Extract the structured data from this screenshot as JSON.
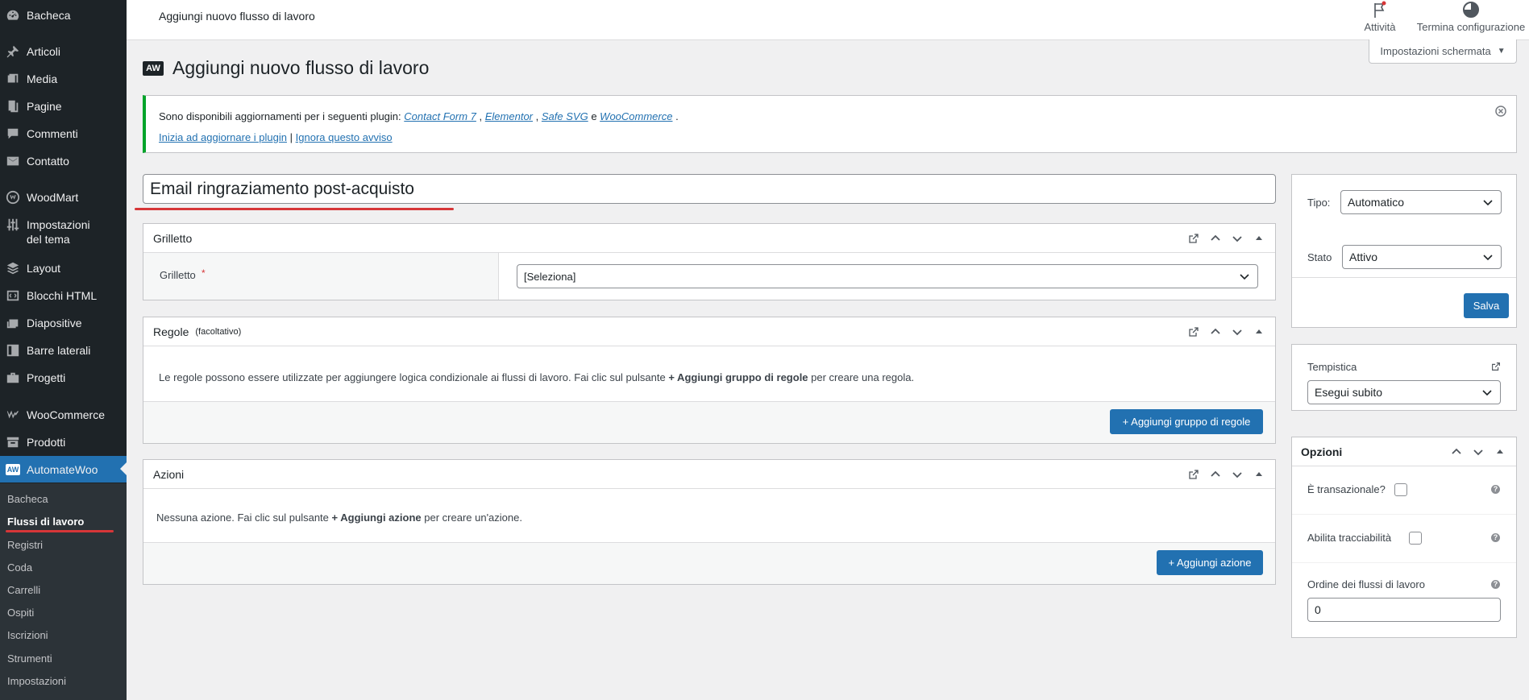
{
  "sidebar": {
    "items": [
      {
        "label": "Bacheca",
        "icon": "dashboard-icon"
      },
      {
        "label": "Articoli",
        "icon": "pin-icon"
      },
      {
        "label": "Media",
        "icon": "media-icon"
      },
      {
        "label": "Pagine",
        "icon": "pages-icon"
      },
      {
        "label": "Commenti",
        "icon": "comments-icon"
      },
      {
        "label": "Contatto",
        "icon": "envelope-icon"
      },
      {
        "label": "WoodMart",
        "icon": "woodmart-icon"
      },
      {
        "label": "Impostazioni del tema",
        "line1": "Impostazioni",
        "line2": "del tema",
        "icon": "sliders-icon"
      },
      {
        "label": "Layout",
        "icon": "layers-icon"
      },
      {
        "label": "Blocchi HTML",
        "icon": "html-block-icon"
      },
      {
        "label": "Diapositive",
        "icon": "slides-icon"
      },
      {
        "label": "Barre laterali",
        "icon": "sidebar-icon"
      },
      {
        "label": "Progetti",
        "icon": "briefcase-icon"
      },
      {
        "label": "WooCommerce",
        "icon": "woocommerce-icon"
      },
      {
        "label": "Prodotti",
        "icon": "archive-icon"
      },
      {
        "label": "AutomateWoo",
        "icon": "automatewoo-icon"
      }
    ],
    "automatewoo_badge": "AW",
    "submenu": [
      "Bacheca",
      "Flussi di lavoro",
      "Registri",
      "Coda",
      "Carrelli",
      "Ospiti",
      "Iscrizioni",
      "Strumenti",
      "Impostazioni"
    ],
    "submenu_current": "Flussi di lavoro"
  },
  "topbar": {
    "title": "Aggiungi nuovo flusso di lavoro",
    "activity_label": "Attività",
    "finish_setup_label": "Termina configurazione"
  },
  "screen_options": {
    "label": "Impostazioni schermata"
  },
  "page": {
    "badge": "AW",
    "heading": "Aggiungi nuovo flusso di lavoro"
  },
  "notice": {
    "text_before": "Sono disponibili aggiornamenti per i seguenti plugin:",
    "plugins": [
      "Contact Form 7",
      "Elementor",
      "Safe SVG",
      "WooCommerce"
    ],
    "sep1": ",",
    "sep2": ",",
    "conjunction": "e",
    "period": ".",
    "update_link": "Inizia ad aggiornare i plugin",
    "divider": "|",
    "dismiss_link": "Ignora questo avviso"
  },
  "workflow": {
    "title_value": "Email ringraziamento post-acquisto"
  },
  "trigger_box": {
    "title": "Grilletto",
    "field_label": "Grilletto",
    "required_mark": "*",
    "select_value": "[Seleziona]"
  },
  "rules_box": {
    "title": "Regole",
    "optional": "(facoltativo)",
    "desc_before": "Le regole possono essere utilizzate per aggiungere logica condizionale ai flussi di lavoro. Fai clic sul pulsante",
    "desc_bold": "+ Aggiungi gruppo di regole",
    "desc_after": "per creare una regola.",
    "button": "+ Aggiungi gruppo di regole"
  },
  "actions_box": {
    "title": "Azioni",
    "desc_before": "Nessuna azione. Fai clic sul pulsante",
    "desc_bold": "+ Aggiungi azione",
    "desc_after": "per creare un'azione.",
    "button": "+ Aggiungi azione"
  },
  "save_box": {
    "type_label": "Tipo:",
    "type_value": "Automatico",
    "status_label": "Stato",
    "status_value": "Attivo",
    "save_button": "Salva"
  },
  "timing_box": {
    "label": "Tempistica",
    "value": "Esegui subito"
  },
  "options_box": {
    "title": "Opzioni",
    "transactional_label": "È transazionale?",
    "tracking_label": "Abilita tracciabilità",
    "order_label": "Ordine dei flussi di lavoro",
    "order_value": "0",
    "help_glyph": "?"
  },
  "colors": {
    "sidebar_bg": "#1d2327",
    "submenu_bg": "#2c3338",
    "accent": "#2271b1",
    "notice_border": "#00a32a",
    "annotation_red": "#d63638"
  }
}
